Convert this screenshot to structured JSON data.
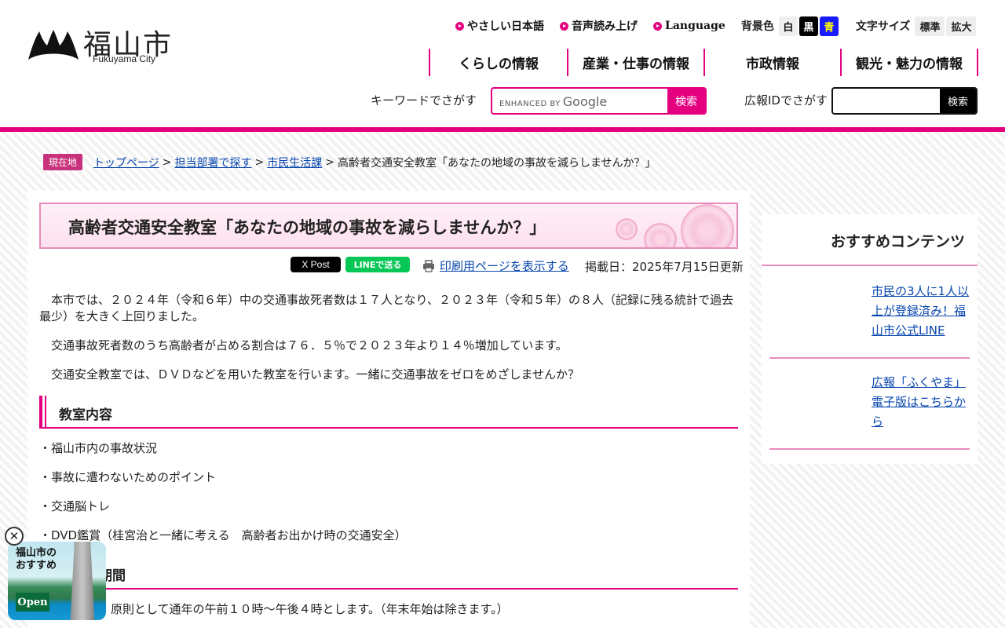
{
  "header": {
    "logo_text": "福山市",
    "logo_sub": "Fukuyama City",
    "util": {
      "easy_japanese": "やさしい日本語",
      "speech": "音声読み上げ",
      "language": "Language",
      "bg_label": "背景色",
      "bg_white": "白",
      "bg_black": "黒",
      "bg_blue": "青",
      "fs_label": "文字サイズ",
      "fs_standard": "標準",
      "fs_large": "拡大"
    },
    "gnav": [
      "くらしの情報",
      "産業・仕事の情報",
      "市政情報",
      "観光・魅力の情報"
    ],
    "search": {
      "keyword_label": "キーワードでさがす",
      "enhanced_by": "ENHANCED BY",
      "google": "Google",
      "keyword_button": "検索",
      "id_label": "広報IDでさがす",
      "id_button": "検索"
    },
    "brand_color": "#e4007f"
  },
  "breadcrumb": {
    "here_label": "現在地",
    "items": [
      "トップページ",
      "担当部署で探す",
      "市民生活課"
    ],
    "current": "高齢者交通安全教室「あなたの地域の事故を減らしませんか？」"
  },
  "article": {
    "title": "高齢者交通安全教室「あなたの地域の事故を減らしませんか？」",
    "share_x": "X Post",
    "share_line": "LINEで送る",
    "print_link": "印刷用ページを表示する",
    "published": "掲載日：2025年7月15日更新",
    "intro": [
      "　本市では、２０２４年（令和６年）中の交通事故死者数は１７人となり、２０２３年（令和５年）の８人（記録に残る統計で過去最少）を大きく上回りました。",
      "　交通事故死者数のうち高齢者が占める割合は７６．５％で２０２３年より１４％増加しています。",
      "　交通安全教室では、ＤＶＤなどを用いた教室を行います。一緒に交通事故をゼロをめざしませんか？"
    ],
    "section1_title": "教室内容",
    "section1_items": [
      "・福山市内の事故状況",
      "・事故に遭わないためのポイント",
      "・交通脳トレ",
      "・DVD鑑賞（桂宮治と一緒に考える　高齢者お出かけ時の交通安全）"
    ],
    "section2_title": "日時・期間",
    "section2_text": "原則として通年の午前１０時～午後４時とします。（年末年始は除きます。）"
  },
  "sidebar": {
    "title": "おすすめコンテンツ",
    "items": [
      "市民の3人に1人以上が登録済み！福山市公式LINE",
      "広報「ふくやま」電子版はこちらから"
    ]
  },
  "promo": {
    "text": "福山市の\nおすすめ",
    "open_label": "Open"
  }
}
